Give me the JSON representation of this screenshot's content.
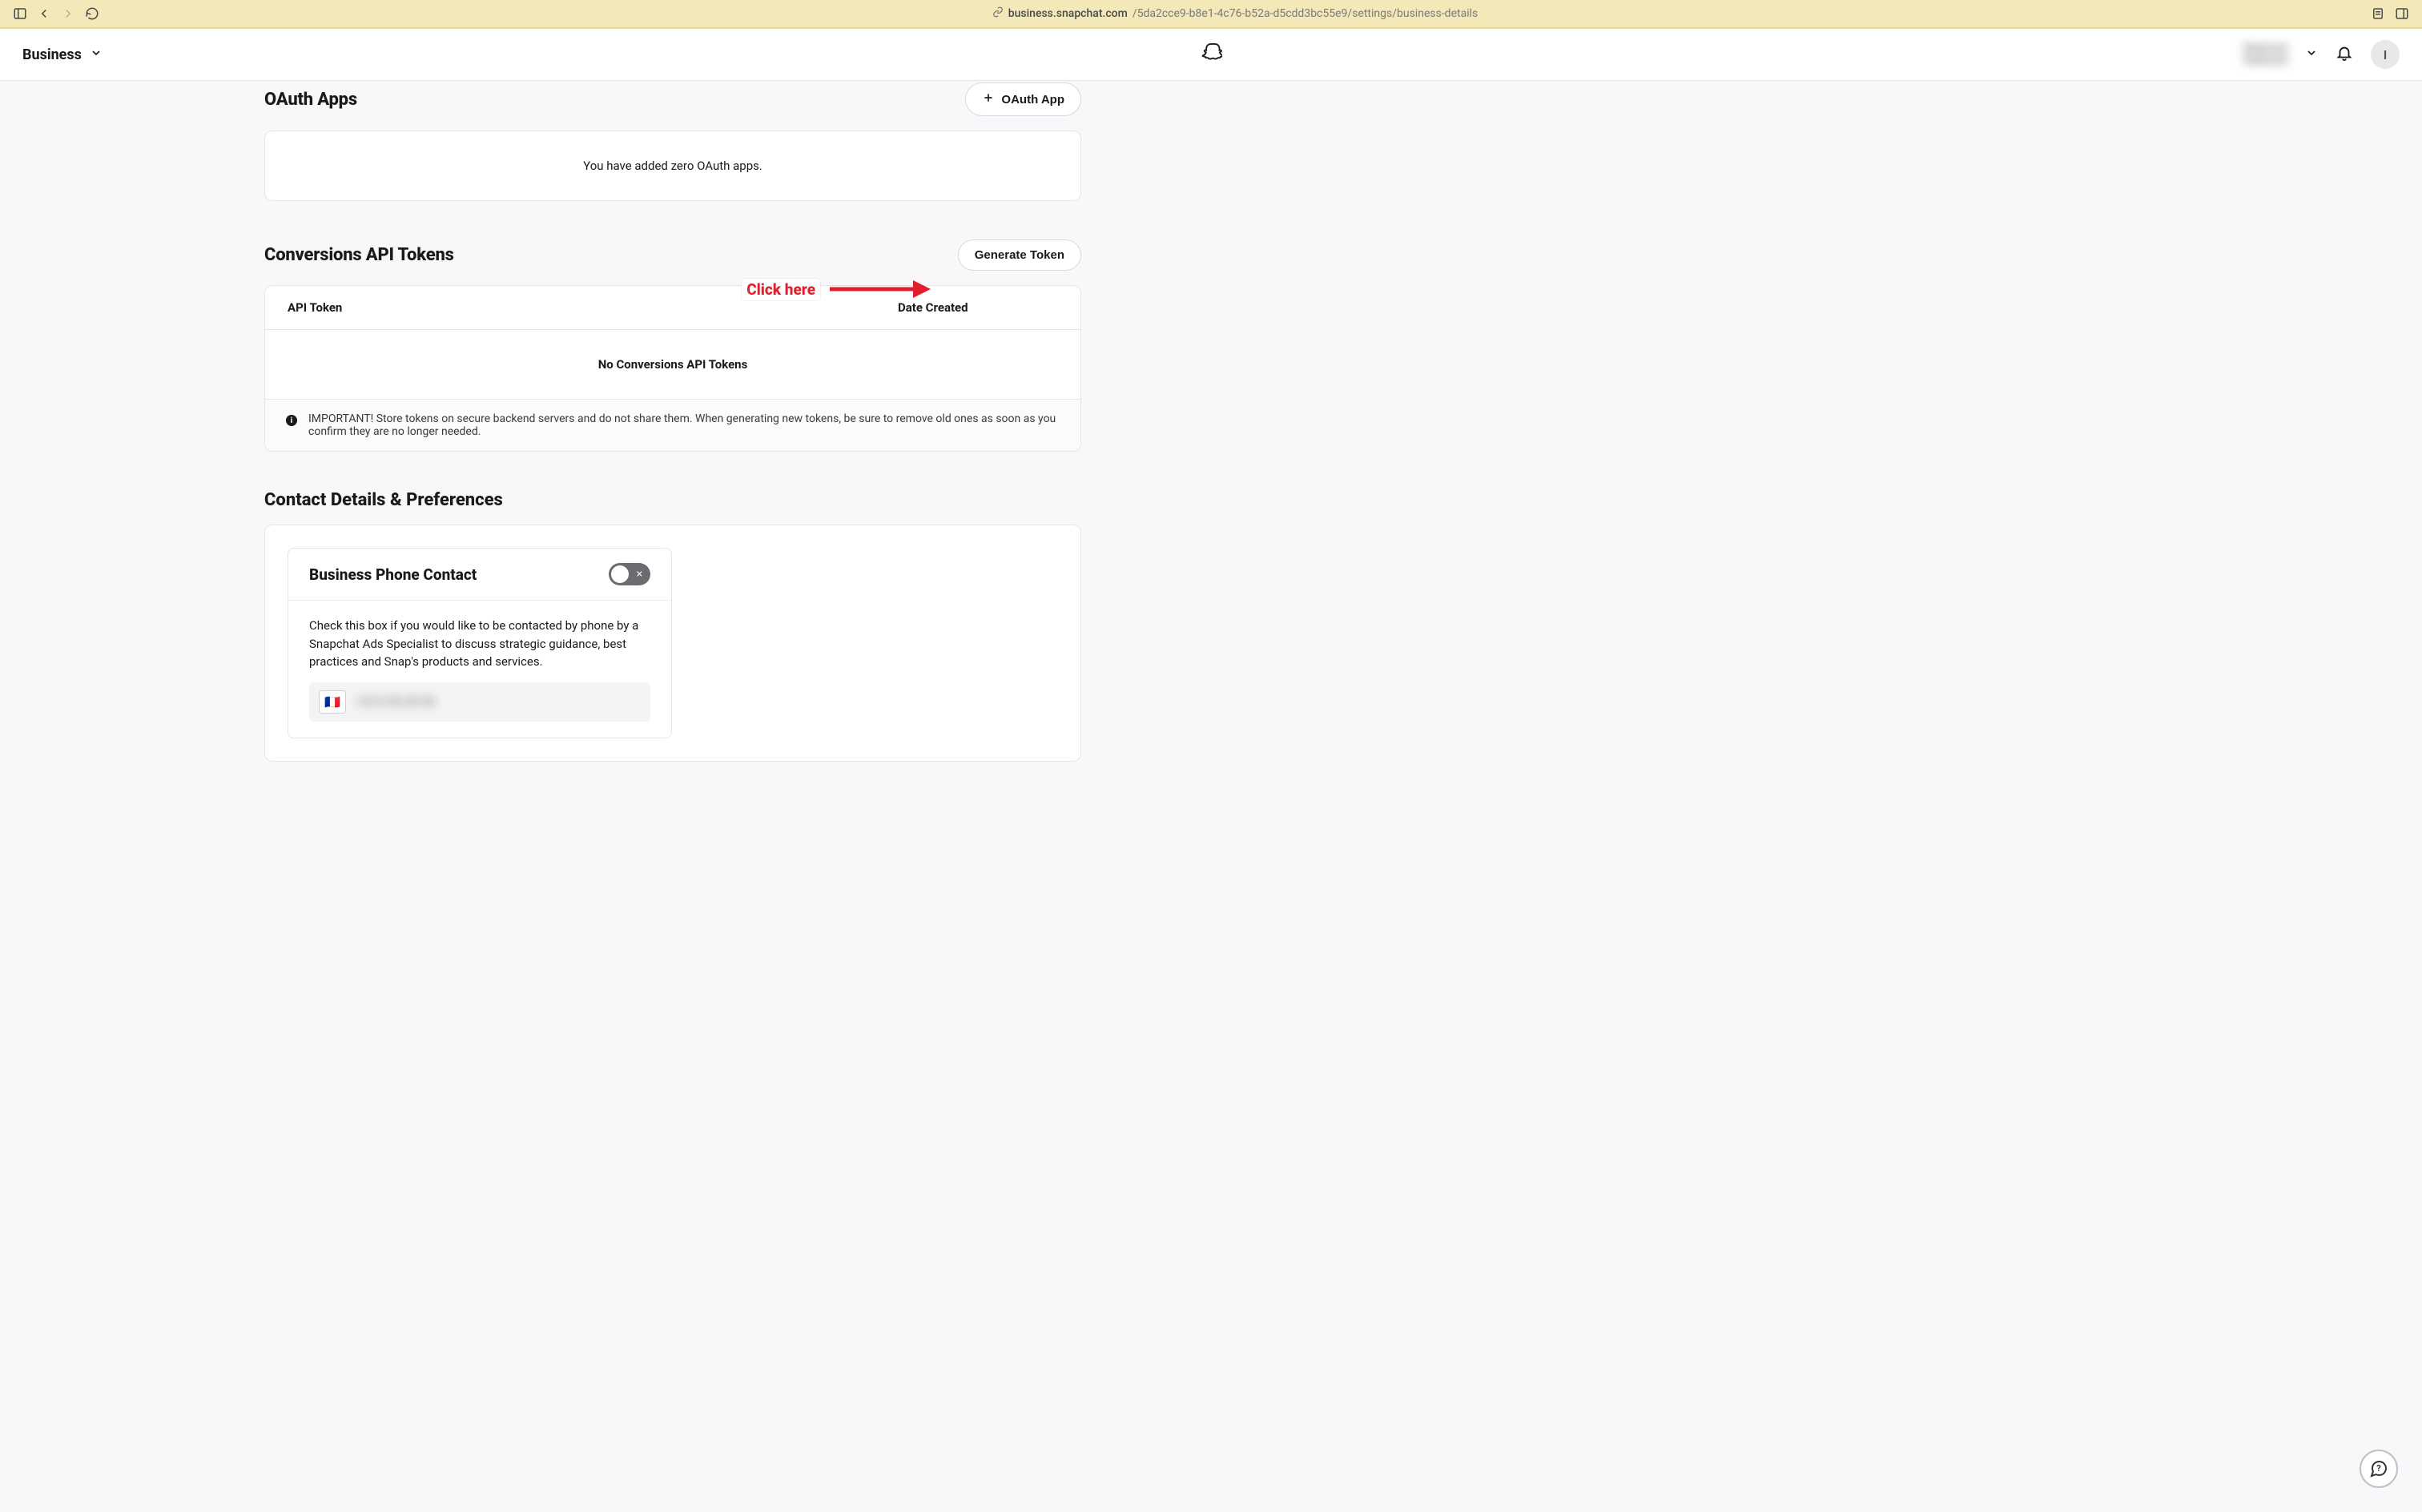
{
  "browser": {
    "domain": "business.snapchat.com",
    "path": "/5da2cce9-b8e1-4c76-b52a-d5cdd3bc55e9/settings/business-details"
  },
  "header": {
    "nav_label": "Business",
    "account_line1": "Redacted",
    "account_line2": "Redacted",
    "avatar_initial": "I"
  },
  "oauth": {
    "title": "OAuth Apps",
    "button_label": "OAuth App",
    "empty": "You have added zero OAuth apps."
  },
  "tokens": {
    "title": "Conversions API Tokens",
    "generate_button": "Generate Token",
    "th_token": "API Token",
    "th_date": "Date Created",
    "empty": "No Conversions API Tokens",
    "footer": "IMPORTANT! Store tokens on secure backend servers and do not share them. When generating new tokens, be sure to remove old ones as soon as you confirm they are no longer needed."
  },
  "contact": {
    "title": "Contact Details & Preferences",
    "card_title": "Business Phone Contact",
    "description": "Check this box if you would like to be contacted by phone by a Snapchat Ads Specialist to discuss strategic guidance, best practices and Snap's products and services.",
    "flag": "🇫🇷",
    "phone_blur": "+33  0  00 00 00"
  },
  "annotation": {
    "label": "Click here"
  }
}
